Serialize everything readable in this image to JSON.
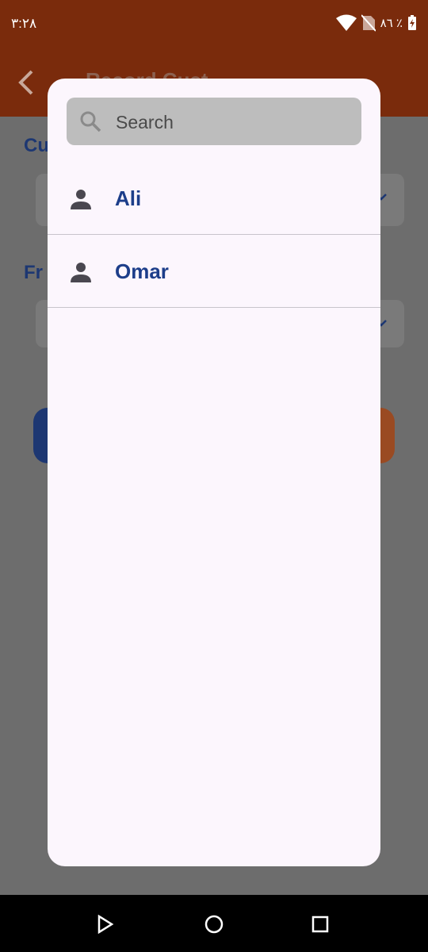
{
  "status_bar": {
    "time": "٣:٢٨",
    "battery_percent": "٨٦ ٪"
  },
  "background": {
    "title": "Record Cust",
    "field_label_1": "Cu",
    "field_label_2": "Fr"
  },
  "dialog": {
    "search": {
      "placeholder": "Search",
      "value": ""
    },
    "items": [
      {
        "label": "Ali",
        "icon": "person-icon"
      },
      {
        "label": "Omar",
        "icon": "person-icon"
      }
    ]
  },
  "nav_bar": {
    "back": "back-triangle-icon",
    "home": "home-circle-icon",
    "recents": "recents-square-icon"
  },
  "colors": {
    "app_bar": "#7a2b0c",
    "dialog_bg": "#fcf6fd",
    "item_text": "#1d3e8a",
    "search_bg": "#bdbdbd"
  }
}
